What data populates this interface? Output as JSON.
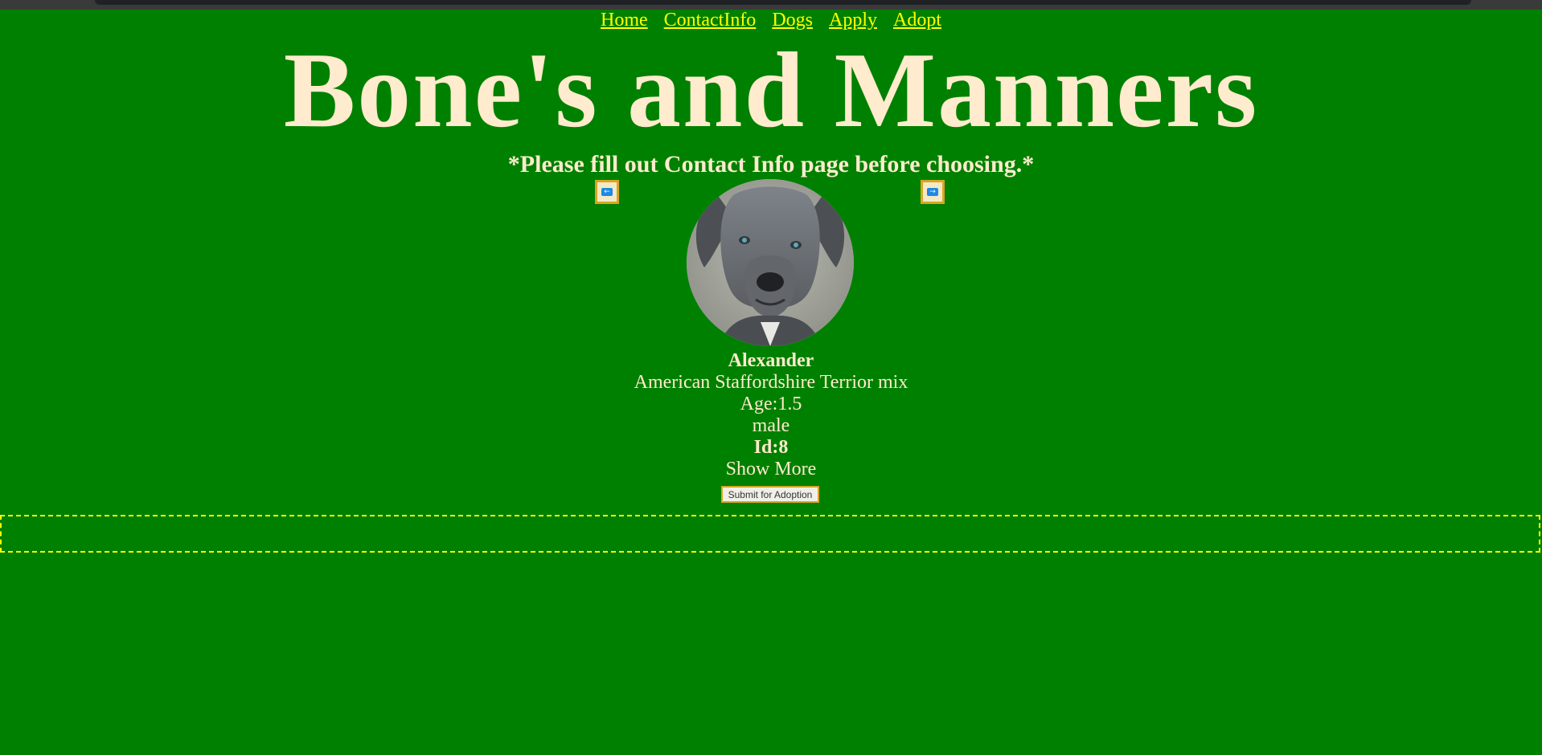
{
  "nav": {
    "links": [
      "Home",
      "ContactInfo",
      "Dogs",
      "Apply",
      "Adopt"
    ]
  },
  "header": {
    "title": "Bone's and Manners",
    "notice": "*Please fill out Contact Info page before choosing.*"
  },
  "carousel": {
    "prev_icon": "left-arrow-icon",
    "next_icon": "right-arrow-icon"
  },
  "dog": {
    "name": "Alexander",
    "breed": "American Staffordshire Terrior mix",
    "age": "Age:1.5",
    "sex": "male",
    "id": "Id:8",
    "show_more": "Show More"
  },
  "actions": {
    "submit_label": "Submit for Adoption"
  },
  "colors": {
    "background": "#008000",
    "link": "#ffff00",
    "text": "#ffebcd",
    "button_border": "#daa520"
  }
}
